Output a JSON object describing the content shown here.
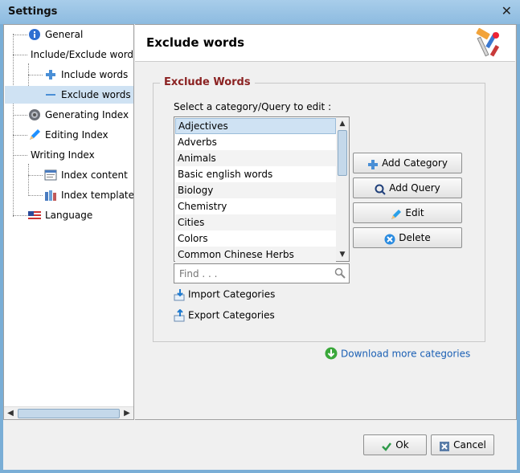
{
  "window": {
    "title": "Settings",
    "close_glyph": "✕"
  },
  "tree": {
    "items": [
      {
        "label": "General",
        "icon": "info-icon"
      },
      {
        "label": "Include/Exclude words",
        "icon": ""
      },
      {
        "label": "Include words",
        "icon": "plus-icon"
      },
      {
        "label": "Exclude words",
        "icon": "minus-icon"
      },
      {
        "label": "Generating Index",
        "icon": "gear-icon"
      },
      {
        "label": "Editing Index",
        "icon": "pencil-icon"
      },
      {
        "label": "Writing Index",
        "icon": ""
      },
      {
        "label": "Index content",
        "icon": "document-icon"
      },
      {
        "label": "Index templates",
        "icon": "books-icon"
      },
      {
        "label": "Language",
        "icon": "flag-icon"
      }
    ],
    "selected": "Exclude words"
  },
  "panel": {
    "title": "Exclude words",
    "group_title": "Exclude Words",
    "select_label": "Select a category/Query to edit :",
    "categories": [
      "Adjectives",
      "Adverbs",
      "Animals",
      "Basic english words",
      "Biology",
      "Chemistry",
      "Cities",
      "Colors",
      "Common Chinese Herbs"
    ],
    "selected_category": "Adjectives",
    "find_placeholder": "Find . . .",
    "buttons": {
      "add_category": "Add Category",
      "add_query": "Add Query",
      "edit": "Edit",
      "delete": "Delete"
    },
    "import_label": "Import Categories",
    "export_label": "Export Categories",
    "download_label": "Download more categories"
  },
  "footer": {
    "ok": "Ok",
    "cancel": "Cancel"
  },
  "colors": {
    "accent": "#8b2222",
    "link": "#1a5fb4",
    "selection": "#cfe2f3"
  }
}
